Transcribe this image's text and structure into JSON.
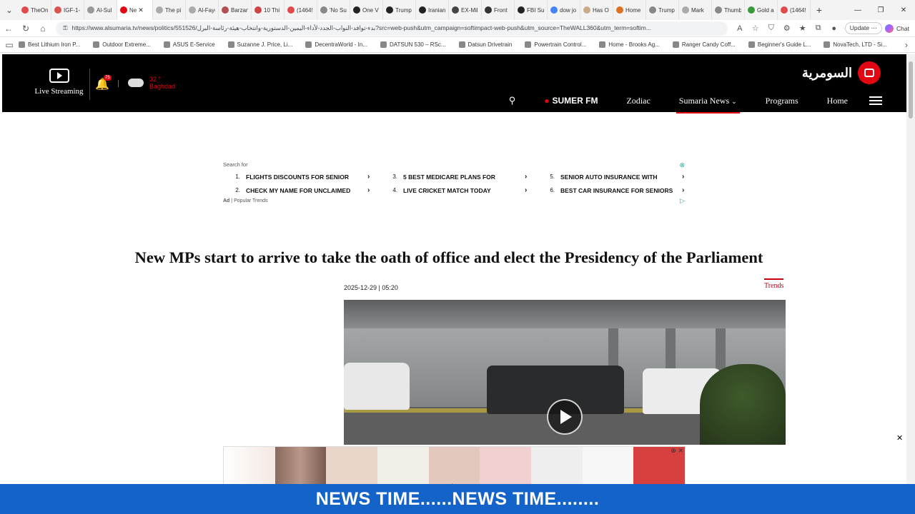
{
  "browser": {
    "tabs": [
      {
        "label": "TheOn",
        "color": "#e04a4a"
      },
      {
        "label": "IGF-1-",
        "color": "#d9534f"
      },
      {
        "label": "Al-Sul",
        "color": "#999999"
      },
      {
        "label": "Ne",
        "color": "#e30613",
        "active": true
      },
      {
        "label": "The pi",
        "color": "#aaaaaa"
      },
      {
        "label": "Al-Faye",
        "color": "#aaaaaa"
      },
      {
        "label": "Barzan",
        "color": "#b05050"
      },
      {
        "label": "10 Thi",
        "color": "#cc4444"
      },
      {
        "label": "(1464!",
        "color": "#e04a4a"
      },
      {
        "label": "'No Su",
        "color": "#888888"
      },
      {
        "label": "One V",
        "color": "#222222"
      },
      {
        "label": "Trump",
        "color": "#222222"
      },
      {
        "label": "Iranian",
        "color": "#222222"
      },
      {
        "label": "EX-Mil",
        "color": "#444444"
      },
      {
        "label": "Front",
        "color": "#333333"
      },
      {
        "label": "FBI Su",
        "color": "#222222"
      },
      {
        "label": "dow jo",
        "color": "#4285f4"
      },
      {
        "label": "Has O",
        "color": "#ccaa88"
      },
      {
        "label": "Home",
        "color": "#e07020"
      },
      {
        "label": "Trump",
        "color": "#888888"
      },
      {
        "label": "Mark",
        "color": "#aaaaaa"
      },
      {
        "label": "Thumb",
        "color": "#888888"
      },
      {
        "label": "Gold a",
        "color": "#3a9a3a"
      },
      {
        "label": "(1464!",
        "color": "#e04a4a"
      }
    ],
    "tab_close": "✕",
    "new_tab": "+",
    "url": "https://www.alsumaria.tv/news/politics/551526/بدء-توافد-النواب-الجدد-لأداء-اليمين-الدستورية-وانتخاب-هيئة-رئاسة-البرل?src=web-push&utm_campaign=softimpact-web-push&utm_source=TheWALL360&utm_term=softim...",
    "update_label": "Update",
    "chat_label": "Chat",
    "bookmarks": [
      "Best Lithium Iron P...",
      "Outdoor Extreme...",
      "ASUS E-Service",
      "Suzanne J. Price, Li...",
      "DecentraWorld - In...",
      "DATSUN 530 – RSc...",
      "Datsun Drivetrain",
      "Powertrain Control...",
      "Home - Brooks Ag...",
      "Ranger Candy Coff...",
      "Beginner's Guide L...",
      "NovaTech, LTD - Si..."
    ]
  },
  "header": {
    "live_label": "Live Streaming",
    "notification_count": "75",
    "temperature": "32 °",
    "city": "Baghdad",
    "logo_text": "السومرية",
    "nav": {
      "sumer_fm": "SUMER FM",
      "zodiac": "Zodiac",
      "sumaria_news": "Sumaria News",
      "programs": "Programs",
      "home": "Home"
    }
  },
  "ad_top": {
    "label": "Search for",
    "items": [
      {
        "num": "1.",
        "text": "FLIGHTS DISCOUNTS FOR SENIOR"
      },
      {
        "num": "3.",
        "text": "5 BEST MEDICARE PLANS FOR"
      },
      {
        "num": "5.",
        "text": "SENIOR AUTO INSURANCE WITH"
      },
      {
        "num": "2.",
        "text": "CHECK MY NAME FOR UNCLAIMED"
      },
      {
        "num": "4.",
        "text": "LIVE CRICKET MATCH TODAY"
      },
      {
        "num": "6.",
        "text": "BEST CAR INSURANCE FOR SENIORS"
      }
    ],
    "footer": "Popular Trends"
  },
  "article": {
    "headline": "New MPs start to arrive to take the oath of office and elect the Presidency of the Parliament",
    "date": "2025-12-29 | 05:20",
    "category": "Trends"
  },
  "ticker_text": "NEWS TIME......NEWS TIME........"
}
